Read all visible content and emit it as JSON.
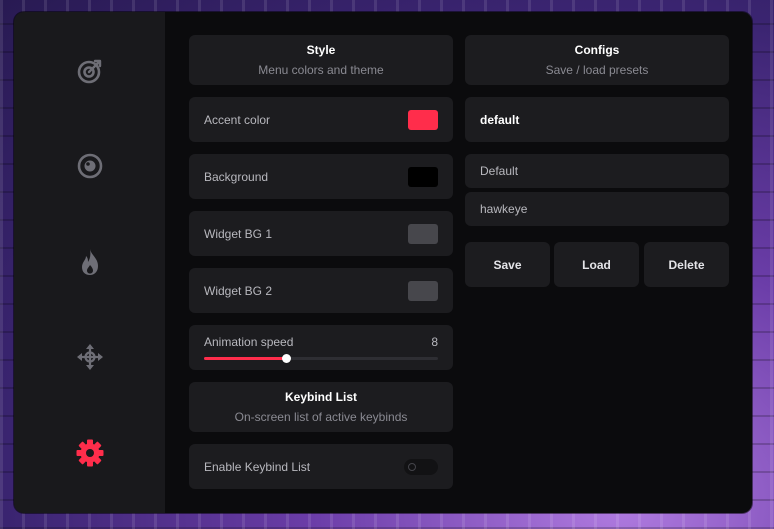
{
  "colors": {
    "accent": "#ff2d4b",
    "icon_default": "#6e6e76",
    "background_swatch": "#000000",
    "widget_bg1_swatch": "#47474c",
    "widget_bg2_swatch": "#47474c"
  },
  "sidebar": {
    "items": [
      {
        "icon": "target-icon",
        "active": false
      },
      {
        "icon": "eye-icon",
        "active": false
      },
      {
        "icon": "flame-icon",
        "active": false
      },
      {
        "icon": "move-arrows-icon",
        "active": false
      },
      {
        "icon": "gear-icon",
        "active": true
      }
    ]
  },
  "style_panel": {
    "title": "Style",
    "subtitle": "Menu colors and theme",
    "accent_label": "Accent color",
    "background_label": "Background",
    "widget_bg1_label": "Widget BG 1",
    "widget_bg2_label": "Widget BG 2",
    "animation_label": "Animation speed",
    "animation_value": "8",
    "animation_fraction": 0.35
  },
  "keybind_panel": {
    "title": "Keybind List",
    "subtitle": "On-screen list of active keybinds",
    "enable_label": "Enable Keybind List",
    "enabled": false
  },
  "configs_panel": {
    "title": "Configs",
    "subtitle": "Save / load presets",
    "current_name": "default",
    "presets": [
      "Default",
      "hawkeye"
    ],
    "save_label": "Save",
    "load_label": "Load",
    "delete_label": "Delete"
  }
}
